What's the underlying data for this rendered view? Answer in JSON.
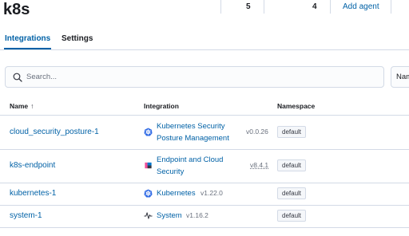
{
  "header": {
    "title": "k8s",
    "stats": [
      "5",
      "4"
    ],
    "add_agent_label": "Add agent"
  },
  "tabs": [
    {
      "label": "Integrations",
      "active": true
    },
    {
      "label": "Settings",
      "active": false
    }
  ],
  "search": {
    "placeholder": "Search...",
    "value": ""
  },
  "filter": {
    "label": "Nam"
  },
  "table": {
    "columns": [
      "Name",
      "Integration",
      "Namespace"
    ],
    "rows": [
      {
        "name": "cloud_security_posture-1",
        "integration_line1": "Kubernetes Security",
        "integration_line2": "Posture Management",
        "version": "v0.0.26",
        "namespace": "default",
        "icon": "kubernetes-icon"
      },
      {
        "name": "k8s-endpoint",
        "integration_line1": "Endpoint and Cloud",
        "integration_line2": "Security",
        "version": "v8.4.1",
        "namespace": "default",
        "icon": "elastic-security-icon"
      },
      {
        "name": "kubernetes-1",
        "integration_line1": "Kubernetes",
        "integration_line2": "",
        "version": "v1.22.0",
        "namespace": "default",
        "icon": "kubernetes-icon"
      },
      {
        "name": "system-1",
        "integration_line1": "System",
        "integration_line2": "",
        "version": "v1.16.2",
        "namespace": "default",
        "icon": "system-activity-icon"
      }
    ]
  },
  "colors": {
    "link": "#0061a6",
    "border": "#d3dae6",
    "kubernetes": "#326ce5",
    "elastic_accent": "#f04e98"
  }
}
